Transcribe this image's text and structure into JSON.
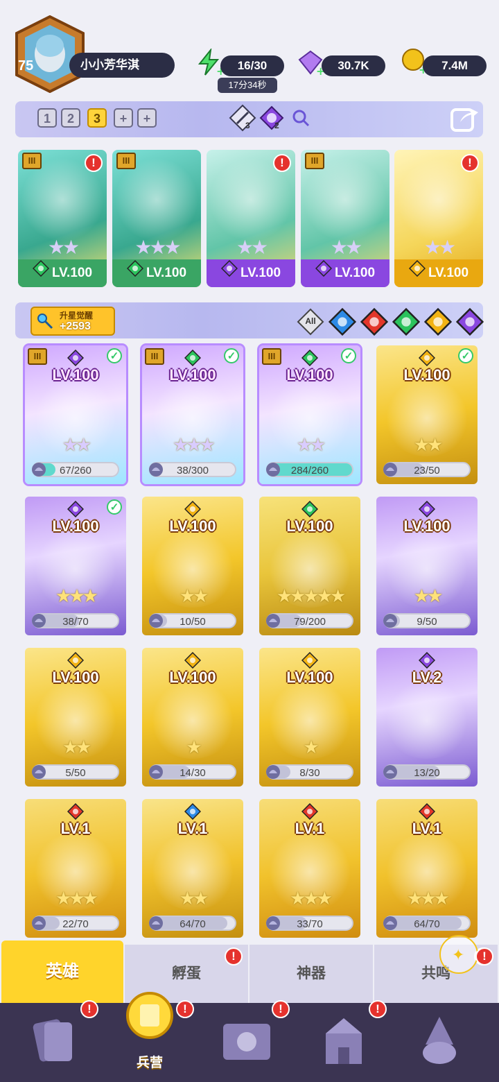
{
  "player": {
    "level": "75",
    "name": "小小芳华淇"
  },
  "resources": {
    "energy": "16/30",
    "energy_timer": "17分34秒",
    "gems": "30.7K",
    "gold": "7.4M"
  },
  "team_bar": {
    "slots": [
      "1",
      "2",
      "3"
    ],
    "active_slot": "3",
    "slot_add": [
      "+",
      "+"
    ],
    "sword_count": "3",
    "moon_count": "2"
  },
  "team": [
    {
      "level": "LV.100",
      "stars": 2,
      "element": "nature",
      "tier": "III",
      "alert": true
    },
    {
      "level": "LV.100",
      "stars": 3,
      "element": "nature",
      "tier": "III",
      "alert": false
    },
    {
      "level": "LV.100",
      "stars": 2,
      "element": "dark",
      "tier": "",
      "alert": true
    },
    {
      "level": "LV.100",
      "stars": 2,
      "element": "dark",
      "tier": "III",
      "alert": false
    },
    {
      "level": "LV.100",
      "stars": 2,
      "element": "light",
      "tier": "",
      "alert": true
    }
  ],
  "awaken": {
    "label": "升星觉醒",
    "value": "+2593"
  },
  "filters": [
    "All",
    "water",
    "fire",
    "nature",
    "light",
    "dark"
  ],
  "heroes": [
    {
      "level": "LV.100",
      "progress": "67/260",
      "ratio": 0.26,
      "element": "dark",
      "tier": "III",
      "check": true,
      "selected": true,
      "stars": 2
    },
    {
      "level": "LV.100",
      "progress": "38/300",
      "ratio": 0.13,
      "element": "nature",
      "tier": "III",
      "check": true,
      "selected": true,
      "stars": 3
    },
    {
      "level": "LV.100",
      "progress": "284/260",
      "ratio": 1.0,
      "element": "nature",
      "tier": "III",
      "check": true,
      "selected": true,
      "stars": 2
    },
    {
      "level": "LV.100",
      "progress": "23/50",
      "ratio": 0.46,
      "element": "light",
      "tier": "",
      "check": true,
      "selected": false,
      "stars": 2
    },
    {
      "level": "LV.100",
      "progress": "38/70",
      "ratio": 0.54,
      "element": "dark",
      "tier": "",
      "check": true,
      "selected": false,
      "stars": 3
    },
    {
      "level": "LV.100",
      "progress": "10/50",
      "ratio": 0.2,
      "element": "light",
      "tier": "",
      "check": false,
      "selected": false,
      "stars": 2
    },
    {
      "level": "LV.100",
      "progress": "79/200",
      "ratio": 0.4,
      "element": "nature",
      "tier": "",
      "check": false,
      "selected": false,
      "stars": 5
    },
    {
      "level": "LV.100",
      "progress": "9/50",
      "ratio": 0.18,
      "element": "dark",
      "tier": "",
      "check": false,
      "selected": false,
      "stars": 2
    },
    {
      "level": "LV.100",
      "progress": "5/50",
      "ratio": 0.1,
      "element": "light",
      "tier": "",
      "check": false,
      "selected": false,
      "stars": 2
    },
    {
      "level": "LV.100",
      "progress": "14/30",
      "ratio": 0.47,
      "element": "light",
      "tier": "",
      "check": false,
      "selected": false,
      "stars": 1
    },
    {
      "level": "LV.100",
      "progress": "8/30",
      "ratio": 0.27,
      "element": "light",
      "tier": "",
      "check": false,
      "selected": false,
      "stars": 1
    },
    {
      "level": "LV.2",
      "progress": "13/20",
      "ratio": 0.65,
      "element": "dark",
      "tier": "",
      "check": false,
      "selected": false,
      "stars": 0
    },
    {
      "level": "LV.1",
      "progress": "22/70",
      "ratio": 0.31,
      "element": "fire",
      "tier": "",
      "check": false,
      "selected": false,
      "stars": 3
    },
    {
      "level": "LV.1",
      "progress": "64/70",
      "ratio": 0.91,
      "element": "water",
      "tier": "",
      "check": false,
      "selected": false,
      "stars": 2
    },
    {
      "level": "LV.1",
      "progress": "33/70",
      "ratio": 0.47,
      "element": "fire",
      "tier": "",
      "check": false,
      "selected": false,
      "stars": 3
    },
    {
      "level": "LV.1",
      "progress": "64/70",
      "ratio": 0.91,
      "element": "fire",
      "tier": "",
      "check": false,
      "selected": false,
      "stars": 3
    }
  ],
  "subtabs": [
    {
      "label": "英雄",
      "active": true,
      "alert": false
    },
    {
      "label": "孵蛋",
      "active": false,
      "alert": true
    },
    {
      "label": "神器",
      "active": false,
      "alert": false
    },
    {
      "label": "共鸣",
      "active": false,
      "alert": true
    }
  ],
  "nav": [
    {
      "icon": "cards-icon",
      "label": "",
      "alert": true
    },
    {
      "icon": "barracks-icon",
      "label": "兵营",
      "alert": true,
      "active": true
    },
    {
      "icon": "map-icon",
      "label": "",
      "alert": true
    },
    {
      "icon": "castle-icon",
      "label": "",
      "alert": true
    },
    {
      "icon": "wizard-icon",
      "label": "",
      "alert": false
    }
  ],
  "colors": {
    "nature": "#2cc35d",
    "dark": "#8a47e0",
    "light": "#f2b313",
    "fire": "#e3372a",
    "water": "#2d8ae6",
    "card_gold": "#f3c62a",
    "card_purple": "#b77af0",
    "accent": "#ffd42b"
  }
}
